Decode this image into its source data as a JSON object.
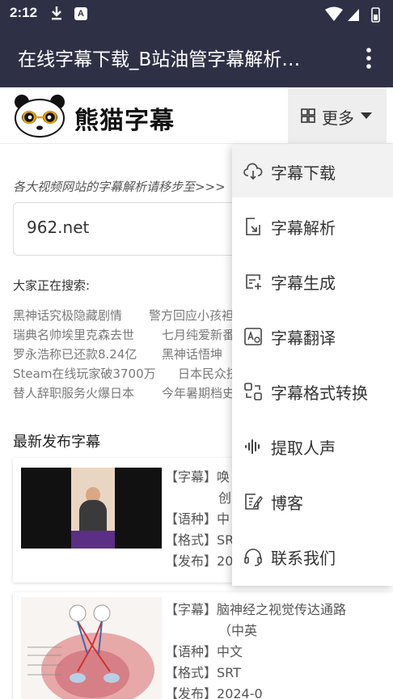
{
  "status_bar": {
    "time": "2:12"
  },
  "app_bar": {
    "title": "在线字幕下载_B站油管字幕解析…"
  },
  "site": {
    "brand": "熊猫字幕",
    "more_label": "更多"
  },
  "main": {
    "hint": "各大视频网站的字幕解析请移步至>>>",
    "search_value": "962.net",
    "searching_label": "大家正在搜索:",
    "hot_searches": [
      [
        "黑神话究极隐藏剧情",
        "警方回应小孩袒"
      ],
      [
        "瑞典名帅埃里克森去世",
        "七月纯爱新番"
      ],
      [
        "罗永浩称已还款8.24亿",
        "黑神话悟坤"
      ],
      [
        "Steam在线玩家破3700万",
        "日本民众挤"
      ],
      [
        "替人辞职服务火爆日本",
        "今年暑期档史"
      ]
    ],
    "latest_title": "最新发布字幕",
    "cards": [
      {
        "subtitle_key": "【字幕】",
        "subtitle_val": "唤",
        "subtitle_val2": "创",
        "lang_key": "【语种】",
        "lang_val": "中",
        "format_key": "【格式】",
        "format_val": "SRT",
        "date_key": "【发布】",
        "date_val": "202"
      },
      {
        "subtitle_key": "【字幕】",
        "subtitle_val": "脑神经之视觉传达通路",
        "subtitle_val2": "（中英",
        "lang_key": "【语种】",
        "lang_val": "中文",
        "format_key": "【格式】",
        "format_val": "SRT",
        "date_key": "【发布】",
        "date_val": "2024-0"
      }
    ]
  },
  "menu": {
    "items": [
      {
        "label": "字幕下载",
        "icon": "cloud-download-icon"
      },
      {
        "label": "字幕解析",
        "icon": "document-parse-icon"
      },
      {
        "label": "字幕生成",
        "icon": "subtitle-add-icon"
      },
      {
        "label": "字幕翻译",
        "icon": "translate-icon"
      },
      {
        "label": "字幕格式转换",
        "icon": "format-convert-icon"
      },
      {
        "label": "提取人声",
        "icon": "voice-wave-icon"
      },
      {
        "label": "博客",
        "icon": "blog-edit-icon"
      },
      {
        "label": "联系我们",
        "icon": "headset-icon"
      }
    ]
  },
  "colors": {
    "app_bar": "#2e3146",
    "menu_active": "#f2f2f2",
    "more_button": "#eeeeee"
  }
}
